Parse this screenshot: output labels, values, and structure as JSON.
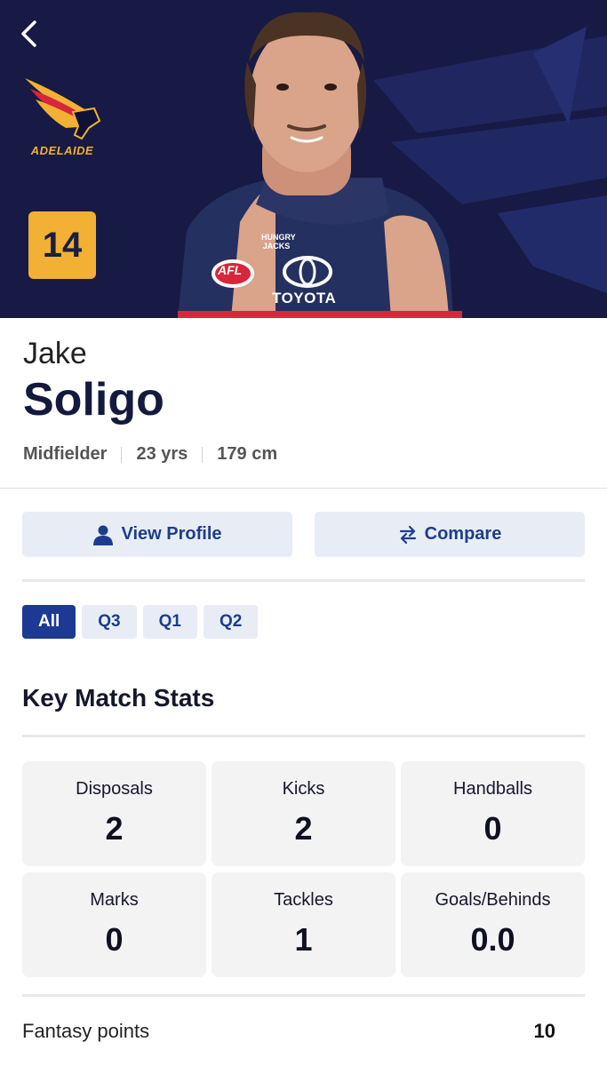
{
  "hero": {
    "club_name": "ADELAIDE",
    "jumper_number": "14",
    "sponsor_top": "HUNGRY JACKS",
    "sponsor_main": "TOYOTA",
    "afl_badge": "AFL",
    "colors": {
      "background": "#171a44",
      "badge": "#f2b134"
    }
  },
  "player": {
    "first_name": "Jake",
    "last_name": "Soligo",
    "position": "Midfielder",
    "age": "23 yrs",
    "height": "179 cm"
  },
  "actions": {
    "view_profile_label": "View Profile",
    "view_profile_icon": "person-icon",
    "compare_label": "Compare",
    "compare_icon": "swap-arrows-icon"
  },
  "filters": [
    {
      "label": "All",
      "active": true
    },
    {
      "label": "Q3",
      "active": false
    },
    {
      "label": "Q1",
      "active": false
    },
    {
      "label": "Q2",
      "active": false
    }
  ],
  "key_stats": {
    "title": "Key Match Stats",
    "items": [
      {
        "label": "Disposals",
        "value": "2"
      },
      {
        "label": "Kicks",
        "value": "2"
      },
      {
        "label": "Handballs",
        "value": "0"
      },
      {
        "label": "Marks",
        "value": "0"
      },
      {
        "label": "Tackles",
        "value": "1"
      },
      {
        "label": "Goals/Behinds",
        "value": "0.0"
      }
    ]
  },
  "fantasy": {
    "label": "Fantasy points",
    "value": "10"
  },
  "colors": {
    "accent": "#1c3a93",
    "chip_bg": "#e8edf5",
    "card_bg": "#f3f3f4"
  }
}
